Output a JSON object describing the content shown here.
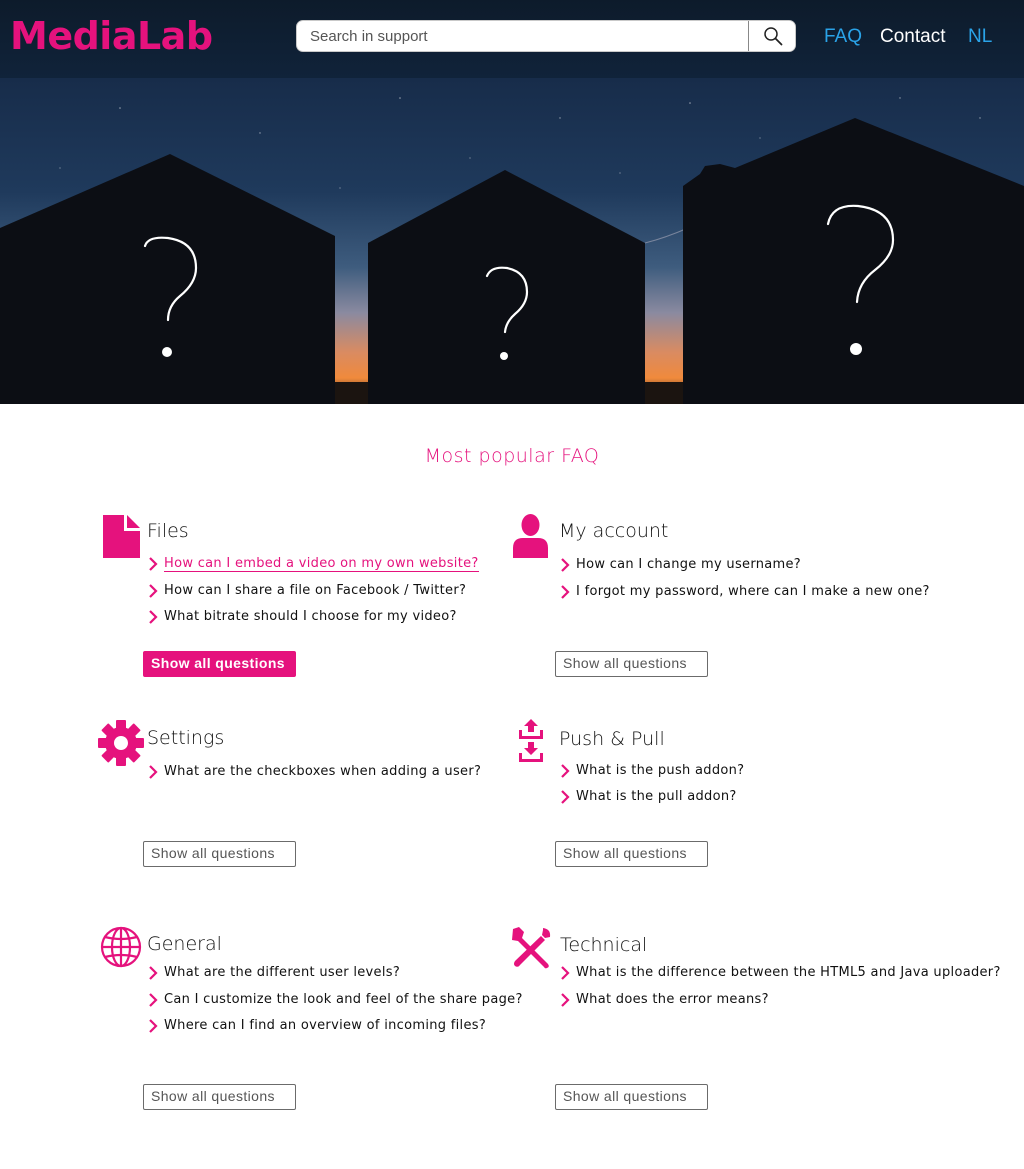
{
  "header": {
    "logo": "MediaLab",
    "search": {
      "placeholder": "Search in support",
      "value": ""
    },
    "nav": {
      "faq": "FAQ",
      "contact": "Contact",
      "lang": "NL"
    }
  },
  "hero": {
    "marks": [
      "?",
      "?",
      "?"
    ]
  },
  "section_title": "Most popular FAQ",
  "show_all_label": "Show all questions",
  "categories": {
    "files": {
      "title": "Files",
      "questions": [
        "How can I embed a video on my own website?",
        "How can I share a file on Facebook / Twitter?",
        "What bitrate should I choose for my video?"
      ]
    },
    "account": {
      "title": "My account",
      "questions": [
        "How can I change my username?",
        "I forgot my password, where can I make a new one?"
      ]
    },
    "settings": {
      "title": "Settings",
      "questions": [
        "What are the checkboxes when adding a user?"
      ]
    },
    "pushpull": {
      "title": "Push & Pull",
      "questions": [
        "What is the push addon?",
        "What is the pull addon?"
      ]
    },
    "general": {
      "title": "General",
      "questions": [
        "What are the different user levels?",
        "Can I customize the look and feel of the share page?",
        "Where can I find an overview of incoming files?"
      ]
    },
    "technical": {
      "title": "Technical",
      "questions": [
        "What is the difference between the HTML5 and Java uploader?",
        "What does the error means?"
      ]
    }
  },
  "colors": {
    "accent": "#e5127d",
    "nav_link": "#2aa3e8",
    "header_bg": "#0d1b2b"
  }
}
